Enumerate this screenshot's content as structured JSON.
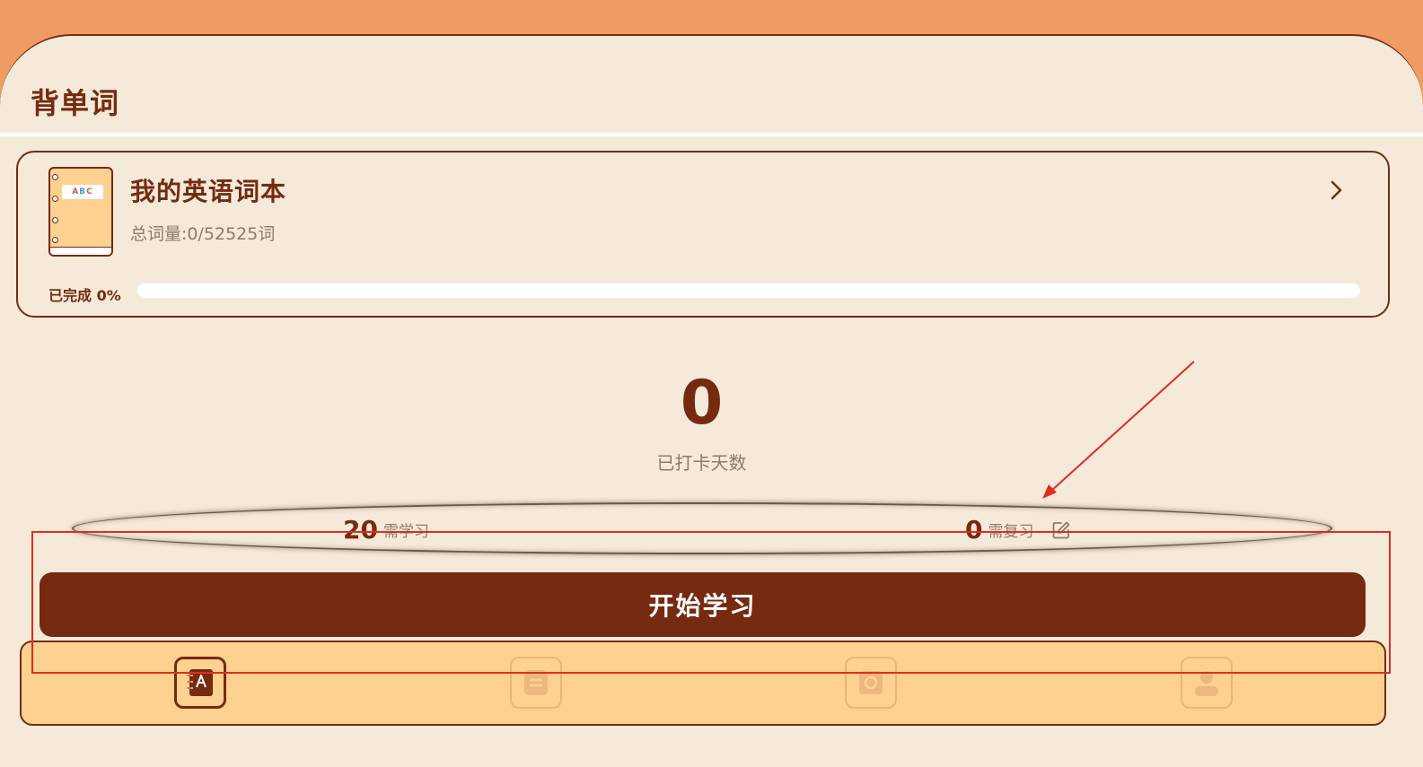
{
  "header": {
    "title": "背单词"
  },
  "book": {
    "name": "我的英语词本",
    "total": "总词量:0/52525词",
    "cover_letters": [
      "A",
      "B",
      "C"
    ],
    "progress_label": "已完成 0%",
    "progress_fraction": 0
  },
  "checkin": {
    "count": "0",
    "label": "已打卡天数"
  },
  "stats": {
    "learn_count": "20",
    "learn_label": "需学习",
    "review_count": "0",
    "review_label": "需复习"
  },
  "actions": {
    "start_label": "开始学习"
  },
  "bottom_nav": {
    "items": [
      {
        "icon": "vocabulary-book-icon",
        "active": true
      },
      {
        "icon": "notebook-list-icon",
        "active": false
      },
      {
        "icon": "camera-icon",
        "active": false
      },
      {
        "icon": "profile-icon",
        "active": false
      }
    ]
  },
  "colors": {
    "accent": "#762b10",
    "background": "#f5eada",
    "top_band": "#ee9c62",
    "nav_bg": "#fdd190",
    "muted_text": "#8e7a6a",
    "annotation": "#e32b1e"
  }
}
